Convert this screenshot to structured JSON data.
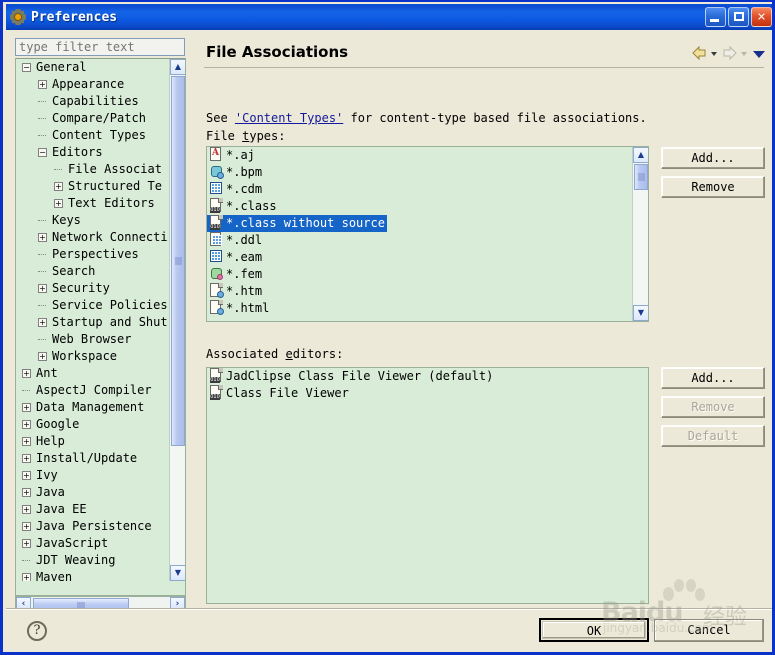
{
  "window": {
    "title": "Preferences",
    "icon": "gear-icon",
    "buttons": {
      "minimize": "minimize-icon",
      "restore": "restore-icon",
      "close": "close-icon"
    },
    "accent_color": "#0a4ad0",
    "frame_color": "#0a32c8",
    "dialog_bg": "#ece9d8"
  },
  "filter": {
    "placeholder": "type filter text",
    "value": ""
  },
  "tree": {
    "items": [
      {
        "label": "General",
        "indent": 0,
        "state": "collapse"
      },
      {
        "label": "Appearance",
        "indent": 1,
        "state": "expand"
      },
      {
        "label": "Capabilities",
        "indent": 1,
        "state": "leaf"
      },
      {
        "label": "Compare/Patch",
        "indent": 1,
        "state": "leaf"
      },
      {
        "label": "Content Types",
        "indent": 1,
        "state": "leaf"
      },
      {
        "label": "Editors",
        "indent": 1,
        "state": "collapse"
      },
      {
        "label": "File Associat",
        "indent": 2,
        "state": "leaf"
      },
      {
        "label": "Structured Te",
        "indent": 2,
        "state": "expand"
      },
      {
        "label": "Text Editors",
        "indent": 2,
        "state": "expand"
      },
      {
        "label": "Keys",
        "indent": 1,
        "state": "leaf"
      },
      {
        "label": "Network Connecti",
        "indent": 1,
        "state": "expand"
      },
      {
        "label": "Perspectives",
        "indent": 1,
        "state": "leaf"
      },
      {
        "label": "Search",
        "indent": 1,
        "state": "leaf"
      },
      {
        "label": "Security",
        "indent": 1,
        "state": "expand"
      },
      {
        "label": "Service Policies",
        "indent": 1,
        "state": "leaf"
      },
      {
        "label": "Startup and Shut",
        "indent": 1,
        "state": "expand"
      },
      {
        "label": "Web Browser",
        "indent": 1,
        "state": "leaf"
      },
      {
        "label": "Workspace",
        "indent": 1,
        "state": "expand"
      },
      {
        "label": "Ant",
        "indent": 0,
        "state": "expand"
      },
      {
        "label": "AspectJ Compiler",
        "indent": 0,
        "state": "leaf"
      },
      {
        "label": "Data Management",
        "indent": 0,
        "state": "expand"
      },
      {
        "label": "Google",
        "indent": 0,
        "state": "expand"
      },
      {
        "label": "Help",
        "indent": 0,
        "state": "expand"
      },
      {
        "label": "Install/Update",
        "indent": 0,
        "state": "expand"
      },
      {
        "label": "Ivy",
        "indent": 0,
        "state": "expand"
      },
      {
        "label": "Java",
        "indent": 0,
        "state": "expand"
      },
      {
        "label": "Java EE",
        "indent": 0,
        "state": "expand"
      },
      {
        "label": "Java Persistence",
        "indent": 0,
        "state": "expand"
      },
      {
        "label": "JavaScript",
        "indent": 0,
        "state": "expand"
      },
      {
        "label": "JDT Weaving",
        "indent": 0,
        "state": "leaf"
      },
      {
        "label": "Maven",
        "indent": 0,
        "state": "expand"
      }
    ],
    "selected_label": "File Associat"
  },
  "page": {
    "title": "File Associations",
    "description_prefix": "See ",
    "description_link": "'Content Types'",
    "description_suffix": " for content-type based file associations.",
    "file_types_label_pre": "File ",
    "file_types_label_mnemonic": "t",
    "file_types_label_post": "ypes:",
    "associated_editors_label_pre": "Associated ",
    "associated_editors_label_mnemonic": "e",
    "associated_editors_label_post": "ditors:",
    "nav": {
      "back": "back-arrow-icon",
      "back_menu": "chevron-down-icon",
      "forward": "forward-arrow-icon",
      "forward_menu": "chevron-down-icon",
      "menu": "view-menu-icon"
    }
  },
  "file_types": {
    "items": [
      {
        "label": "*.aj",
        "icon": "aspectj-file-icon",
        "selected": false
      },
      {
        "label": "*.bpm",
        "icon": "bpm-file-icon",
        "selected": false
      },
      {
        "label": "*.cdm",
        "icon": "cdm-file-icon",
        "selected": false
      },
      {
        "label": "*.class",
        "icon": "class-file-icon",
        "selected": false
      },
      {
        "label": "*.class without source",
        "icon": "class-nosrc-icon",
        "selected": true
      },
      {
        "label": "*.ddl",
        "icon": "ddl-file-icon",
        "selected": false
      },
      {
        "label": "*.eam",
        "icon": "eam-file-icon",
        "selected": false
      },
      {
        "label": "*.fem",
        "icon": "fem-file-icon",
        "selected": false
      },
      {
        "label": "*.htm",
        "icon": "html-file-icon",
        "selected": false
      },
      {
        "label": "*.html",
        "icon": "html-file-icon",
        "selected": false
      }
    ]
  },
  "associated_editors": {
    "items": [
      {
        "label": "JadClipse Class File Viewer (default)",
        "icon": "class-file-icon"
      },
      {
        "label": "Class File Viewer",
        "icon": "class-file-icon"
      }
    ]
  },
  "buttons": {
    "add_file_type": {
      "label": "Add...",
      "mnemonic": "A",
      "enabled": true
    },
    "remove_file_type": {
      "label": "Remove",
      "mnemonic": "R",
      "enabled": true
    },
    "add_editor": {
      "label": "Add...",
      "mnemonic": "d",
      "enabled": true
    },
    "remove_editor": {
      "label": "Remove",
      "mnemonic": "",
      "enabled": false
    },
    "default_editor": {
      "label": "Default",
      "mnemonic": "",
      "enabled": false
    }
  },
  "footer": {
    "help": "?",
    "ok": "OK",
    "cancel": "Cancel"
  },
  "watermark": {
    "brand": "Baidu",
    "brand_cn": "经验",
    "sub": "jingyan.baidu.com"
  }
}
